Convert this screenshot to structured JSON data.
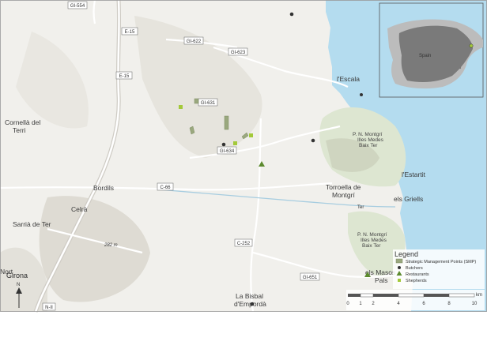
{
  "colors": {
    "sea": "#b4dcef",
    "land": "#f1f0ec",
    "mountain": "#e1dfd8",
    "park": "#dde6d1",
    "road": "#ffffff",
    "highway": "#d9d7d2",
    "inset_land": "#bcbcbc",
    "inset_spain": "#7a7a7a",
    "smp": "#9aa87e",
    "butchers": "#333333",
    "restaurants": "#5c8a2e",
    "shepherds": "#a3c93a"
  },
  "roads": {
    "gi554": "GI-554",
    "e15a": "E-15",
    "gi622": "GI-622",
    "gi623": "GI-623",
    "e15b": "E-15",
    "gi631": "GI-631",
    "gi634": "GI-634",
    "c66": "C-66",
    "c252": "C-252",
    "gi651": "GI-651",
    "n2": "N-II"
  },
  "places": {
    "lescala": "l'Escala",
    "cornella1": "Cornellà del",
    "cornella2": "Terri",
    "bordils": "Bordils",
    "celra": "Celrà",
    "sarria": "Sarrià de Ter",
    "girona": "Girona",
    "nort": "Nort",
    "torroella1": "Torroella de",
    "torroella2": "Montgrí",
    "estartit": "l'Estartit",
    "griells": "els Griells",
    "masos1": "els Masos",
    "masos2": "Pals",
    "bisbal1": "La Bisbal",
    "bisbal2": "d'Empordà",
    "park1a": "P. N. Montgrí",
    "park1b": "Illes Medes",
    "park1c": "Baix Ter",
    "park2a": "P. N. Montgrí",
    "park2b": "Illes Medes",
    "park2c": "Baix Ter",
    "river": "Ter",
    "peak": "282 m"
  },
  "inset": {
    "label": "Spain"
  },
  "legend": {
    "title": "Legend",
    "items": [
      {
        "label": "Strategic Management Points (SMP)",
        "symbol": "rect"
      },
      {
        "label": "Butchers",
        "symbol": "circle"
      },
      {
        "label": "Restaurants",
        "symbol": "triangle"
      },
      {
        "label": "Shepherds",
        "symbol": "square"
      }
    ]
  },
  "scalebar": {
    "unit": "km",
    "ticks": [
      "0",
      "1",
      "2",
      "4",
      "6",
      "8",
      "10"
    ]
  },
  "north": "N"
}
